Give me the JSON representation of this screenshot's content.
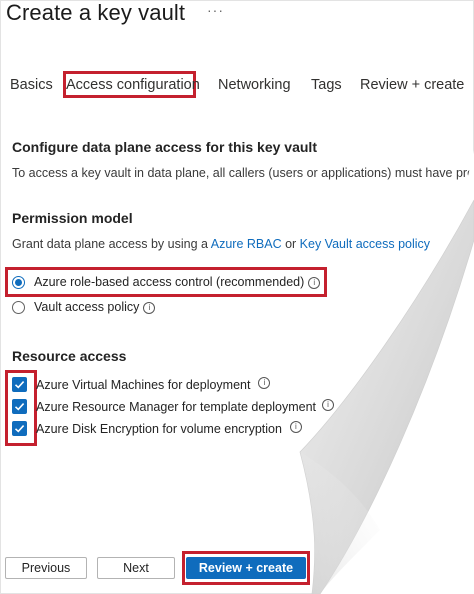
{
  "page": {
    "title": "Create a key vault",
    "more": "···"
  },
  "tabs": [
    {
      "label": "Basics"
    },
    {
      "label": "Access configuration"
    },
    {
      "label": "Networking"
    },
    {
      "label": "Tags"
    },
    {
      "label": "Review + create"
    }
  ],
  "section_data_plane": {
    "heading": "Configure data plane access for this key vault",
    "text": "To access a key vault in data plane, all callers (users or applications) must have prop"
  },
  "permission_model": {
    "heading": "Permission model",
    "text_prefix": "Grant data plane access by using a ",
    "link_rbac": "Azure RBAC",
    "text_or": " or ",
    "link_policy": "Key Vault access policy",
    "options": [
      {
        "label": "Azure role-based access control (recommended)",
        "selected": true
      },
      {
        "label": "Vault access policy",
        "selected": false
      }
    ]
  },
  "resource_access": {
    "heading": "Resource access",
    "items": [
      {
        "label": "Azure Virtual Machines for deployment",
        "checked": true
      },
      {
        "label": "Azure Resource Manager for template deployment",
        "checked": true
      },
      {
        "label": "Azure Disk Encryption for volume encryption",
        "checked": true
      }
    ]
  },
  "footer": {
    "previous": "Previous",
    "next": "Next",
    "review": "Review + create"
  },
  "colors": {
    "accent": "#0f6cbd",
    "highlight": "#c4202e"
  },
  "icons": {
    "info": "info-icon",
    "check": "checkmark-icon",
    "more": "ellipsis-icon"
  }
}
